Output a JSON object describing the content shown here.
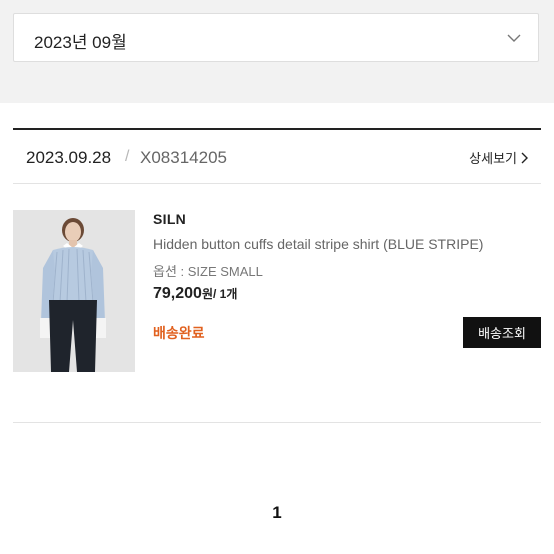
{
  "filter": {
    "month_value": "2023년 09월",
    "chevron_icon": "chevron-down-icon"
  },
  "order": {
    "date": "2023.09.28",
    "separator": "/",
    "order_number": "X08314205",
    "detail_link_label": "상세보기",
    "detail_link_icon": "chevron-right-icon",
    "item": {
      "image_description_icon": "product-thumbnail",
      "brand": "SILN",
      "name": "Hidden button cuffs detail stripe shirt (BLUE STRIPE)",
      "option": "옵션 : SIZE SMALL",
      "price": "79,200",
      "price_unit": "원/ 1개",
      "status": "배송완료",
      "status_color": "#e1611f",
      "track_button_label": "배송조회"
    }
  },
  "pagination": {
    "current_page": "1"
  },
  "colors": {
    "background_band": "#f2f2f2",
    "accent": "#e1611f",
    "button_bg": "#111111"
  }
}
